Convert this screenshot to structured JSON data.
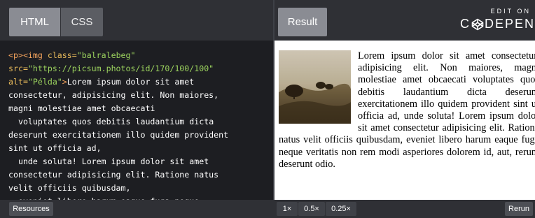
{
  "editor": {
    "tabs": {
      "html": "HTML",
      "css": "CSS"
    },
    "code": [
      {
        "cls": "tk-tag",
        "text": "<p><img "
      },
      {
        "cls": "tk-attr",
        "text": "class="
      },
      {
        "cls": "tk-val",
        "text": "\"balralebeg\""
      },
      {
        "cls": "tk-attr",
        "text": "\nsrc="
      },
      {
        "cls": "tk-val",
        "text": "\"https://picsum.photos/id/170/100/100\""
      },
      {
        "cls": "tk-attr",
        "text": "\nalt="
      },
      {
        "cls": "tk-val",
        "text": "\"Példa\""
      },
      {
        "cls": "tk-tag",
        "text": ">"
      },
      {
        "cls": "tk-text",
        "text": "Lorem ipsum dolor sit amet\nconsectetur, adipisicing elit. Non maiores,\nmagni molestiae amet obcaecati\n  voluptates quos debitis laudantium dicta\ndeserunt exercitationem illo quidem provident\nsint ut officia ad,\n  unde soluta! Lorem ipsum dolor sit amet\nconsectetur adipisicing elit. Ratione natus\nvelit officiis quibusdam,\n  eveniet libero harum eaque fuga neque"
      }
    ]
  },
  "result": {
    "tab": "Result",
    "brand": {
      "edit_on": "EDIT ON",
      "name_left": "C",
      "name_right": "DEPEN"
    },
    "paragraph": "Lorem ipsum dolor sit amet consectetur, adipisicing elit. Non maiores, magni molestiae amet obcaecati voluptates quos debitis laudantium dicta deserunt exercitationem illo quidem provident sint ut officia ad, unde soluta! Lorem ipsum dolor sit amet consectetur adipisicing elit. Ratione natus velit officiis quibusdam, eveniet libero harum eaque fuga neque veritatis non rem modi asperiores dolorem id, aut, rerum deserunt odio."
  },
  "bottombar": {
    "resources": "Resources",
    "zoom": [
      "1×",
      "0.5×",
      "0.25×"
    ],
    "rerun": "Rerun"
  }
}
